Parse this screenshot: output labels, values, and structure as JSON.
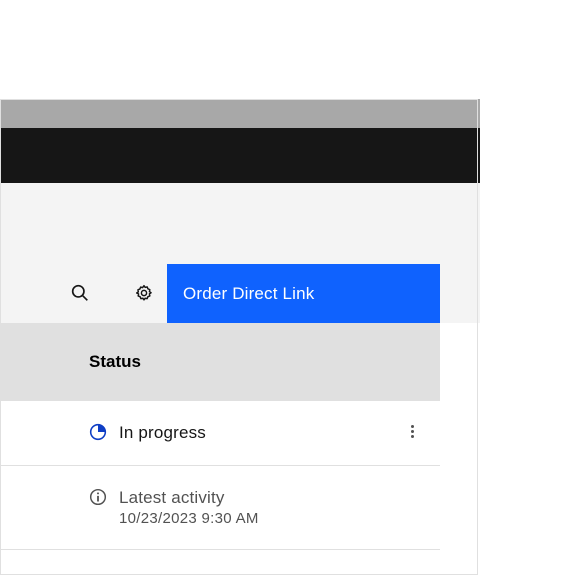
{
  "toolbar": {
    "order_button": "Order Direct Link"
  },
  "table": {
    "column_header": "Status",
    "rows": [
      {
        "status": "In progress"
      },
      {
        "label": "Latest activity",
        "timestamp": "10/23/2023 9:30 AM"
      }
    ]
  }
}
